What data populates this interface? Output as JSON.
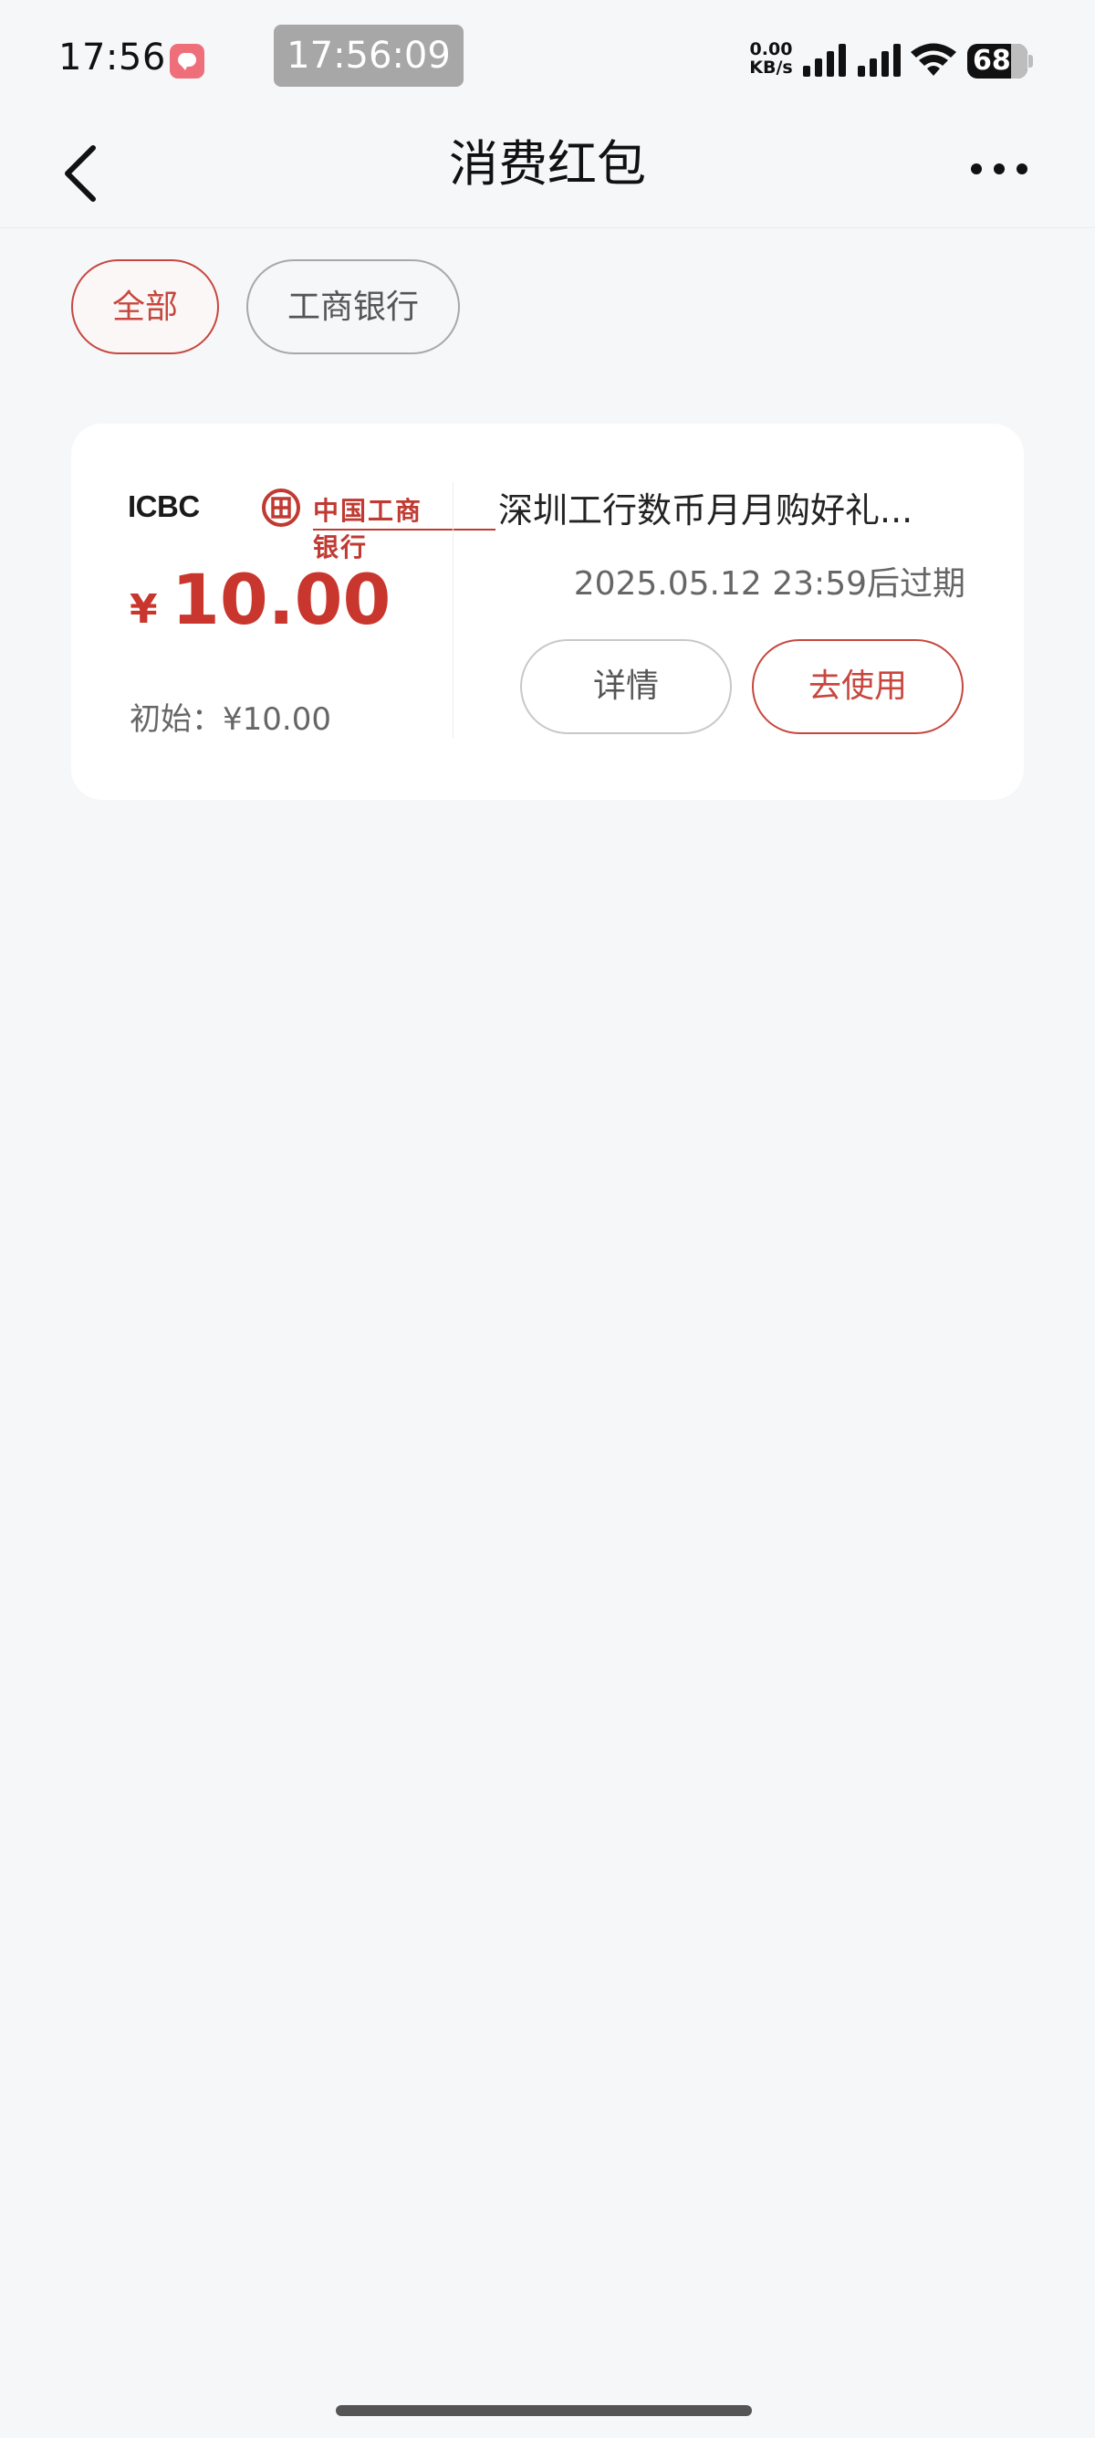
{
  "status_bar": {
    "time": "17:56",
    "clock_overlay": "17:56:09",
    "net_speed_value": "0.00",
    "net_speed_unit": "KB/s",
    "battery": "68"
  },
  "nav": {
    "title": "消费红包"
  },
  "filters": [
    {
      "label": "全部",
      "selected": true
    },
    {
      "label": "工商银行",
      "selected": false
    }
  ],
  "coupon": {
    "bank_logo_latin": "ICBC",
    "bank_logo_cn": "中国工商银行",
    "currency_symbol": "¥",
    "amount": "10.00",
    "initial_label": "初始：¥10.00",
    "title": "深圳工行数币月月购好礼...",
    "expiry": "2025.05.12 23:59后过期",
    "detail_button": "详情",
    "use_button": "去使用"
  },
  "colors": {
    "accent": "#c7473f",
    "background": "#f6f7f9",
    "card": "#ffffff"
  }
}
